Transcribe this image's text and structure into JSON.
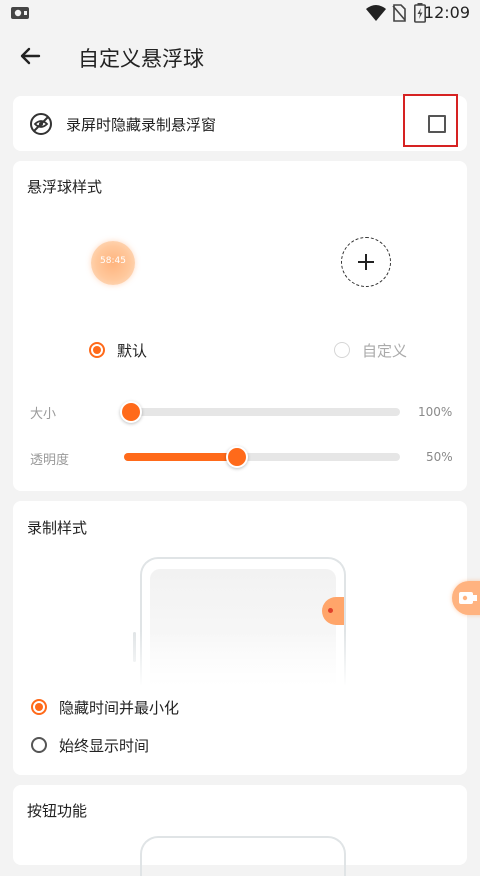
{
  "status_bar": {
    "time": "12:09"
  },
  "app_bar": {
    "title": "自定义悬浮球"
  },
  "hide_row": {
    "label": "录屏时隐藏录制悬浮窗",
    "checked": false
  },
  "ball_style": {
    "title": "悬浮球样式",
    "preview_time": "58:45",
    "options": [
      {
        "label": "默认",
        "selected": true
      },
      {
        "label": "自定义",
        "selected": false
      }
    ],
    "size": {
      "label": "大小",
      "value_text": "100%",
      "value": 0
    },
    "opacity": {
      "label": "透明度",
      "value_text": "50%",
      "value": 0.5
    }
  },
  "record_style": {
    "title": "录制样式",
    "options": [
      {
        "label": "隐藏时间并最小化",
        "selected": true
      },
      {
        "label": "始终显示时间",
        "selected": false
      }
    ]
  },
  "button_function": {
    "title": "按钮功能"
  },
  "colors": {
    "accent": "#ff6a1a",
    "highlight_box": "#d62222"
  }
}
